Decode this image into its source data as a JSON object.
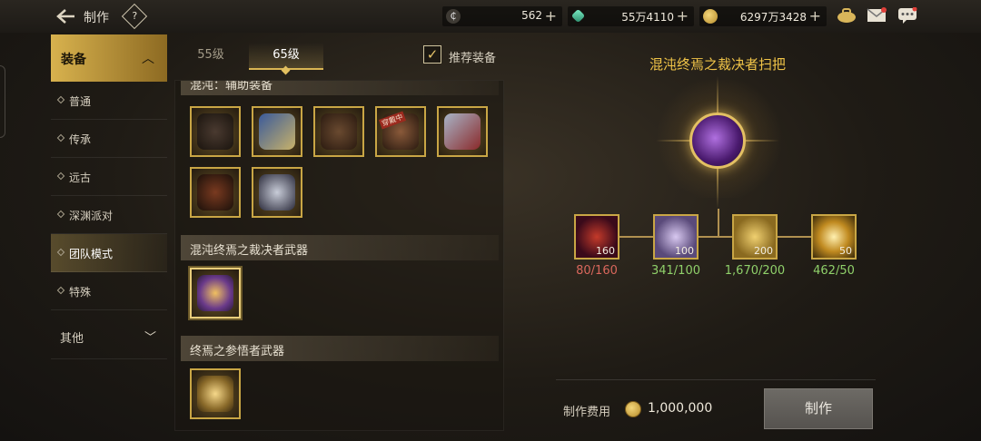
{
  "header": {
    "back_icon": "back-arrow-icon",
    "title": "制作",
    "help_label": "?"
  },
  "currencies": [
    {
      "name": "c-currency",
      "value": "562"
    },
    {
      "name": "gem-currency",
      "value": "55万4110"
    },
    {
      "name": "gold-currency",
      "value": "6297万3428"
    }
  ],
  "sidebar": {
    "header": "装备",
    "items": [
      {
        "label": "普通"
      },
      {
        "label": "传承"
      },
      {
        "label": "远古"
      },
      {
        "label": "深渊派对"
      },
      {
        "label": "团队模式"
      },
      {
        "label": "特殊"
      }
    ],
    "other": "其他"
  },
  "level_tabs": [
    {
      "label": "55级"
    },
    {
      "label": "65级"
    }
  ],
  "recommend": {
    "label": "推荐装备",
    "checked": true
  },
  "sections": [
    {
      "title": "混沌：辅助装备"
    },
    {
      "title": "混沌终焉之裁决者武器"
    },
    {
      "title": "终焉之参悟者武器"
    }
  ],
  "slot_badge": "穿戴中",
  "target": {
    "name": "混沌终焉之裁决者扫把"
  },
  "materials": [
    {
      "qty": "160",
      "count": "80/160",
      "status_color": "#d9675c"
    },
    {
      "qty": "100",
      "count": "341/100",
      "status_color": "#8fd06a"
    },
    {
      "qty": "200",
      "count": "1,670/200",
      "status_color": "#8fd06a"
    },
    {
      "qty": "50",
      "count": "462/50",
      "status_color": "#8fd06a"
    }
  ],
  "fee": {
    "label": "制作费用",
    "value": "1,000,000"
  },
  "craft_button": "制作"
}
